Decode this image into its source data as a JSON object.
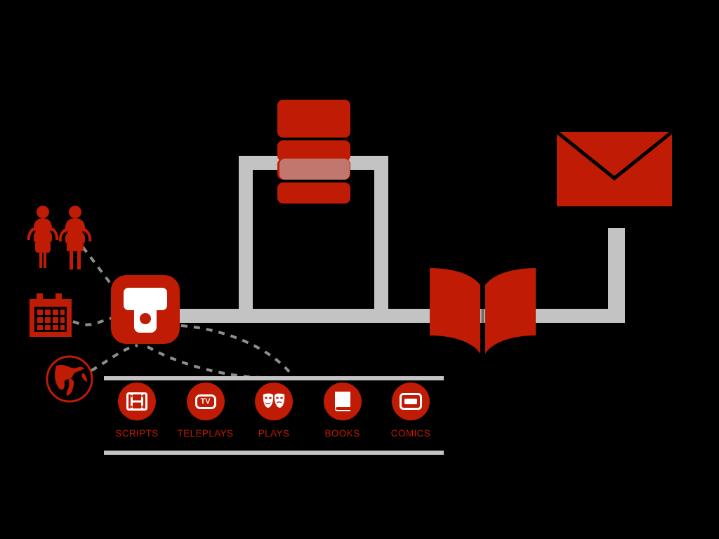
{
  "diagram": {
    "title": "",
    "theme": {
      "background": "#000000",
      "accent_red": "#bf1b05",
      "pipe_gray": "#c3c3c3",
      "icon_white": "#ffffff"
    },
    "hub": {
      "name": "transcription-platform-logo",
      "icon": "letter-t-microphone-icon",
      "label": ""
    },
    "sources": [
      {
        "name": "people",
        "icon": "two-people-icon",
        "label": ""
      },
      {
        "name": "schedule",
        "icon": "calendar-icon",
        "label": ""
      },
      {
        "name": "global",
        "icon": "globe-icon",
        "label": ""
      }
    ],
    "nodes": [
      {
        "name": "database",
        "icon": "database-stack-icon",
        "label": ""
      },
      {
        "name": "mail",
        "icon": "envelope-icon",
        "label": ""
      },
      {
        "name": "publication",
        "icon": "open-book-icon",
        "label": ""
      }
    ],
    "categories": {
      "items": [
        {
          "label": "SCRIPTS",
          "icon": "film-strip-icon"
        },
        {
          "label": "TELEPLAYS",
          "icon": "tv-badge-icon",
          "badge_text": "TV"
        },
        {
          "label": "PLAYS",
          "icon": "theatre-masks-icon"
        },
        {
          "label": "BOOKS",
          "icon": "closed-book-icon"
        },
        {
          "label": "COMICS",
          "icon": "comic-panel-icon"
        }
      ]
    }
  }
}
